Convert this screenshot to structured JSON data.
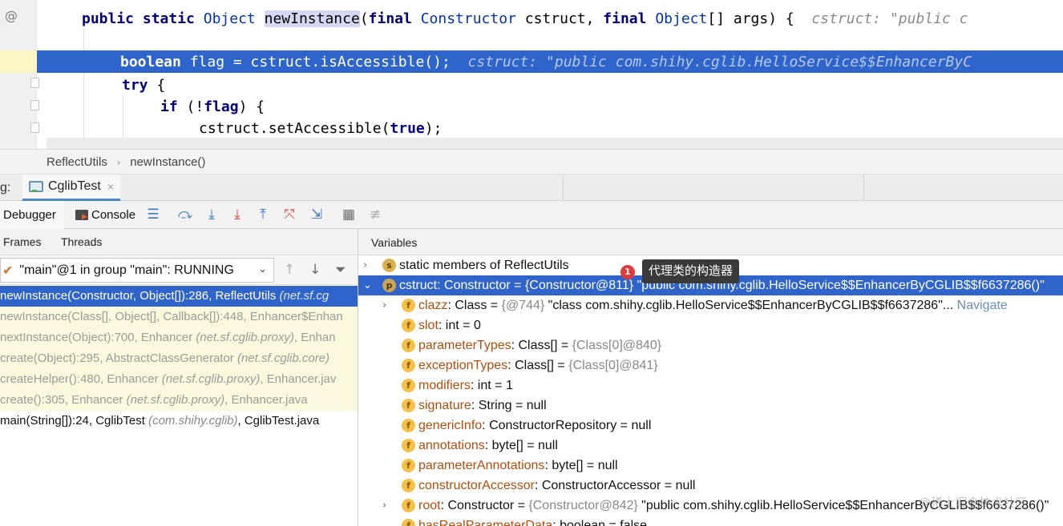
{
  "editor": {
    "gutter_symbol": "@",
    "line1": {
      "kw1": "public static",
      "type1": "Object",
      "method": "newInstance",
      "open": "(",
      "kw2": "final",
      "type2": "Constructor",
      "mid1": " cstruct, ",
      "kw3": "final",
      "type3": "Object",
      "rest": "[] args) {",
      "hint": "cstruct: \"public c"
    },
    "line2": {
      "kw": "boolean",
      "text": " flag = cstruct.isAccessible();",
      "flag_kw": "flag",
      "hint": "cstruct: \"public com.shihy.cglib.HelloService$$EnhancerByC"
    },
    "line3": {
      "kw": "try",
      "rest": " {"
    },
    "line4": {
      "kw": "if",
      "open": " (!",
      "flag": "flag",
      "rest": ") {"
    },
    "line5": {
      "pre": "cstruct.setAccessible(",
      "kw": "true",
      "post": ");"
    }
  },
  "breadcrumb": {
    "items": [
      "ReflectUtils",
      "newInstance()"
    ],
    "separator": "›"
  },
  "debug_tabs": {
    "label": "g:",
    "session": "CglibTest",
    "close": "×"
  },
  "toolbar": {
    "debugger_label": "Debugger",
    "console_label": "Console",
    "icons": [
      "menu-icon",
      "step-over-icon",
      "step-into-icon",
      "force-step-into-icon",
      "step-out-icon",
      "drop-frame-icon",
      "run-to-cursor-icon",
      "evaluate-icon",
      "trace-icon"
    ]
  },
  "frames_panel": {
    "tabs": [
      "Frames",
      "Threads"
    ],
    "thread_selector": "\"main\"@1 in group \"main\": RUNNING",
    "frames": [
      {
        "text": "newInstance(Constructor, Object[]):286, ReflectUtils ",
        "pkg": "(net.sf.cg",
        "tail": "",
        "kind": "sel"
      },
      {
        "text": "newInstance(Class[], Object[], Callback[]):448, Enhancer$Enhan",
        "pkg": "",
        "tail": "",
        "kind": "lib"
      },
      {
        "text": "nextInstance(Object):700, Enhancer ",
        "pkg": "(net.sf.cglib.proxy)",
        "tail": ", Enhan",
        "kind": "lib"
      },
      {
        "text": "create(Object):295, AbstractClassGenerator ",
        "pkg": "(net.sf.cglib.core)",
        "tail": "",
        "kind": "lib"
      },
      {
        "text": "createHelper():480, Enhancer ",
        "pkg": "(net.sf.cglib.proxy)",
        "tail": ", Enhancer.jav",
        "kind": "lib"
      },
      {
        "text": "create():305, Enhancer ",
        "pkg": "(net.sf.cglib.proxy)",
        "tail": ", Enhancer.java",
        "kind": "lib"
      },
      {
        "text": "main(String[]):24, CglibTest ",
        "pkg": "(com.shihy.cglib)",
        "tail": ", CglibTest.java",
        "kind": "user"
      }
    ]
  },
  "variables_panel": {
    "title": "Variables",
    "rows": [
      {
        "expander": "›",
        "icon": "s",
        "name": "",
        "type": "static members of ReflectUtils",
        "eq": "",
        "ref": "",
        "value": "",
        "link": "",
        "kind": "static"
      },
      {
        "expander": "⌄",
        "icon": "p",
        "name": "cstruct",
        "type": ": Constructor",
        "eq": " = ",
        "ref": "{Constructor@811}",
        "value": " \"public com.shihy.cglib.HelloService$$EnhancerByCGLIB$$f6637286()\"",
        "link": "",
        "kind": "sel"
      },
      {
        "expander": "›",
        "icon": "f",
        "name": "clazz",
        "type": ": Class",
        "eq": " = ",
        "ref": "{@744}",
        "value": " \"class com.shihy.cglib.HelloService$$EnhancerByCGLIB$$f6637286\"...",
        "link": " Navigate",
        "kind": "child"
      },
      {
        "expander": "",
        "icon": "f",
        "name": "slot",
        "type": ": int",
        "eq": " = ",
        "ref": "",
        "value": "0",
        "link": "",
        "kind": "child"
      },
      {
        "expander": "",
        "icon": "f",
        "name": "parameterTypes",
        "type": ": Class[]",
        "eq": " = ",
        "ref": "{Class[0]@840}",
        "value": "",
        "link": "",
        "kind": "child"
      },
      {
        "expander": "",
        "icon": "f",
        "name": "exceptionTypes",
        "type": ": Class[]",
        "eq": " = ",
        "ref": "{Class[0]@841}",
        "value": "",
        "link": "",
        "kind": "child"
      },
      {
        "expander": "",
        "icon": "f",
        "name": "modifiers",
        "type": ": int",
        "eq": " = ",
        "ref": "",
        "value": "1",
        "link": "",
        "kind": "child"
      },
      {
        "expander": "",
        "icon": "f",
        "name": "signature",
        "type": ": String",
        "eq": " = ",
        "ref": "",
        "value": "null",
        "link": "",
        "kind": "child"
      },
      {
        "expander": "",
        "icon": "f",
        "name": "genericInfo",
        "type": ": ConstructorRepository",
        "eq": " = ",
        "ref": "",
        "value": "null",
        "link": "",
        "kind": "child"
      },
      {
        "expander": "",
        "icon": "f",
        "name": "annotations",
        "type": ": byte[]",
        "eq": " = ",
        "ref": "",
        "value": "null",
        "link": "",
        "kind": "child"
      },
      {
        "expander": "",
        "icon": "f",
        "name": "parameterAnnotations",
        "type": ": byte[]",
        "eq": " = ",
        "ref": "",
        "value": "null",
        "link": "",
        "kind": "child"
      },
      {
        "expander": "",
        "icon": "f",
        "name": "constructorAccessor",
        "type": ": ConstructorAccessor",
        "eq": " = ",
        "ref": "",
        "value": "null",
        "link": "",
        "kind": "child"
      },
      {
        "expander": "›",
        "icon": "f",
        "name": "root",
        "type": ": Constructor",
        "eq": " = ",
        "ref": "{Constructor@842}",
        "value": " \"public com.shihy.cglib.HelloService$$EnhancerByCGLIB$$f6637286()\"",
        "link": "",
        "kind": "child"
      },
      {
        "expander": "",
        "icon": "f",
        "name": "hasRealParameterData",
        "type": ": boolean",
        "eq": " = ",
        "ref": "",
        "value": "false",
        "link": "",
        "kind": "child"
      }
    ]
  },
  "annotation": {
    "badge": "1",
    "tooltip": "代理类的构造器"
  },
  "watermark": "@稀土掘金技术社区",
  "colors": {
    "selection": "#2f65ca",
    "keyword": "#000080",
    "field_name": "#b44c0b",
    "library_frame_bg": "#fcf8dd"
  }
}
